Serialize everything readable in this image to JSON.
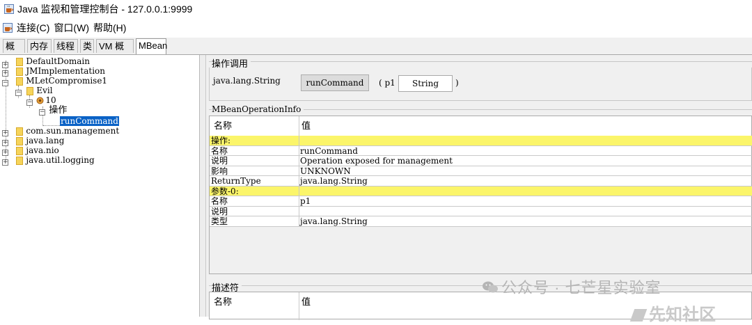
{
  "window": {
    "title": "Java 监视和管理控制台 - 127.0.0.1:9999"
  },
  "menu": {
    "items": [
      "连接(C)",
      "窗口(W)",
      "帮助(H)"
    ]
  },
  "tabs": [
    "概览",
    "内存",
    "线程",
    "类",
    "VM 概要",
    "MBean"
  ],
  "active_tab": "MBean",
  "tree": {
    "nodes": [
      "DefaultDomain",
      "JMImplementation",
      "MLetCompromise1",
      "Evil",
      "10",
      "操作",
      "runCommand",
      "com.sun.management",
      "java.lang",
      "java.nio",
      "java.util.logging"
    ],
    "selected": "runCommand"
  },
  "operation": {
    "section_title": "操作调用",
    "return_type": "java.lang.String",
    "button_label": "runCommand",
    "open_paren": "( p1",
    "param_value": "String",
    "close_paren": ")"
  },
  "info": {
    "section_title": "MBeanOperationInfo",
    "header_name": "名称",
    "header_value": "值",
    "rows": [
      {
        "name": "操作:",
        "value": "",
        "highlight": true
      },
      {
        "name": "名称",
        "value": "runCommand"
      },
      {
        "name": "说明",
        "value": "Operation exposed for management"
      },
      {
        "name": "影响",
        "value": "UNKNOWN"
      },
      {
        "name": "ReturnType",
        "value": "java.lang.String"
      },
      {
        "name": "参数-0:",
        "value": "",
        "highlight": true
      },
      {
        "name": "名称",
        "value": "p1"
      },
      {
        "name": "说明",
        "value": ""
      },
      {
        "name": "类型",
        "value": "java.lang.String"
      }
    ]
  },
  "descriptor": {
    "section_title": "描述符",
    "header_name": "名称",
    "header_value": "值"
  },
  "watermark": {
    "text": "公众号 · 七芒星实验室",
    "text2": "先知社区"
  },
  "colors": {
    "selection": "#0a62c6",
    "highlight_row": "#fbf56a",
    "folder": "#f6d45a"
  }
}
